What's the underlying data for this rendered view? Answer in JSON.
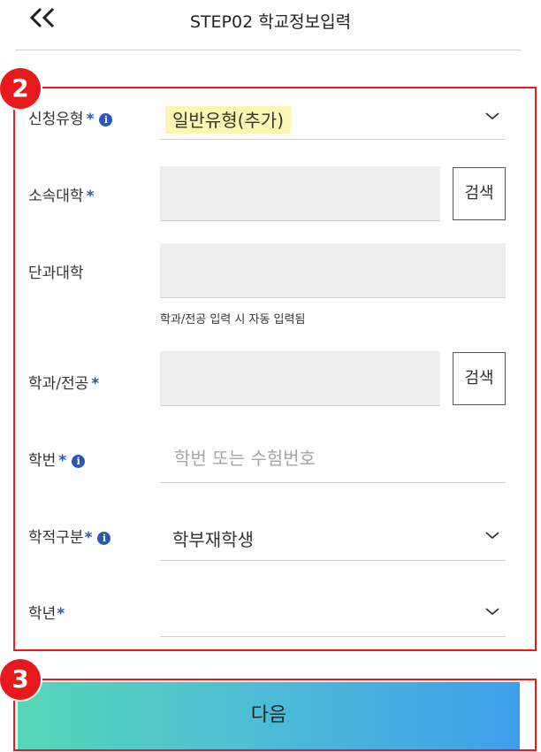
{
  "header": {
    "title": "STEP02 학교정보입력",
    "back_icon": "double-chevron-left-icon"
  },
  "annotations": {
    "step2": "2",
    "step3": "3",
    "frame_color": "#e8191b"
  },
  "form": {
    "application_type": {
      "label": "신청유형",
      "required": "*",
      "value": "일반유형(추가)",
      "highlight": "#fbf7b2"
    },
    "university": {
      "label": "소속대학",
      "required": "*",
      "search_label": "검색"
    },
    "college": {
      "label": "단과대학",
      "hint": "학과/전공 입력 시 자동 입력됨"
    },
    "department": {
      "label": "학과/전공",
      "required": "*",
      "search_label": "검색"
    },
    "student_id": {
      "label": "학번",
      "required": "*",
      "placeholder": "학번 또는 수험번호",
      "value": ""
    },
    "enrollment_status": {
      "label": "학적구분",
      "required": "*",
      "value": "학부재학생"
    },
    "grade": {
      "label": "학년",
      "required": "*",
      "value": ""
    }
  },
  "next_button": {
    "label": "다음",
    "gradient_start": "#57d6b6",
    "gradient_end": "#3ca0ea"
  },
  "colors": {
    "required_mark": "#2a58b8",
    "input_bg": "#eeeeee"
  }
}
